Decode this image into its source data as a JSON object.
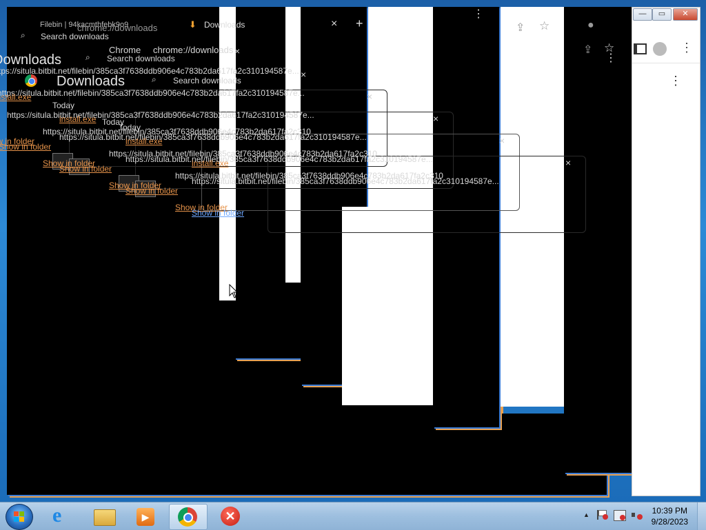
{
  "browser": {
    "app_name": "Chrome",
    "url": "chrome://downloads",
    "tab_title": "Downloads",
    "other_tab_title": "Filebin | 94kacmthfebk9o9",
    "new_tab_symbol": "+",
    "close_symbol": "×"
  },
  "downloads_page": {
    "heading": "Downloads",
    "search_placeholder": "Search downloads",
    "section_label": "Today",
    "item": {
      "filename": "install.exe",
      "url": "https://situla.bitbit.net/filebin/385ca3f7638ddb906e4c783b2da617fa2c310194587e...",
      "url_short": "https://situla.bitbit.net/filebin/385ca3f7638ddb906e4c783b2da617fa2c310",
      "action": "Show in folder"
    }
  },
  "window_controls": {
    "minimize": "—",
    "maximize": "▭",
    "close": "✕"
  },
  "taskbar": {
    "pinned": [
      {
        "name": "internet-explorer",
        "label": "e"
      },
      {
        "name": "file-explorer",
        "label": ""
      },
      {
        "name": "media-player",
        "label": "▶"
      },
      {
        "name": "chrome",
        "label": ""
      },
      {
        "name": "error-app",
        "label": "✕"
      }
    ],
    "tray": {
      "chevron": "▲",
      "time": "10:39 PM",
      "date": "9/28/2023"
    }
  },
  "colors": {
    "link_orange": "#e6934a",
    "link_blue": "#6fa8ff",
    "desktop_blue": "#1c5fa8"
  }
}
